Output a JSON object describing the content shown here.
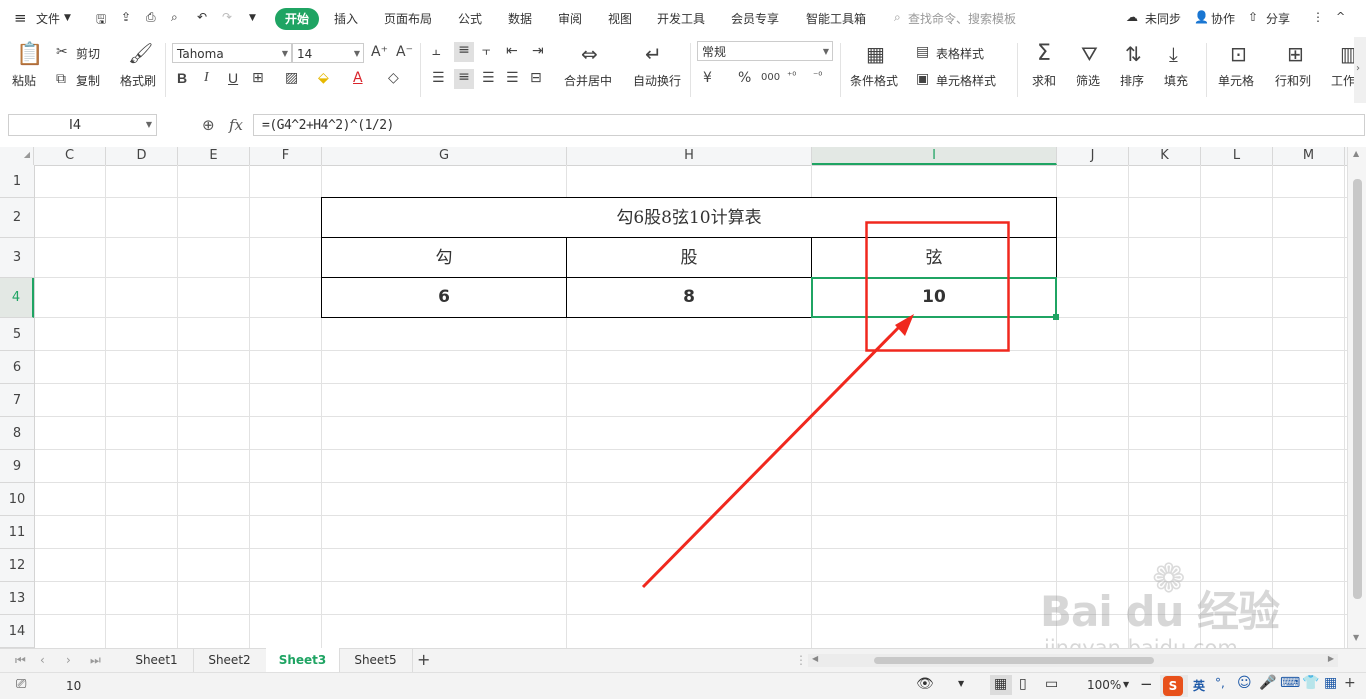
{
  "menu": {
    "file_label": "文件",
    "tabs": [
      "开始",
      "插入",
      "页面布局",
      "公式",
      "数据",
      "审阅",
      "视图",
      "开发工具",
      "会员专享",
      "智能工具箱"
    ],
    "search_placeholder": "查找命令、搜索模板",
    "sync": "未同步",
    "collab": "协作",
    "share": "分享"
  },
  "ribbon": {
    "paste": "粘贴",
    "cut": "剪切",
    "copy": "复制",
    "format_painter": "格式刷",
    "font_name": "Tahoma",
    "font_size": "14",
    "bold": "B",
    "italic": "I",
    "underline": "U",
    "merge_center": "合并居中",
    "wrap_text": "自动换行",
    "number_format": "常规",
    "currency": "¥",
    "percent": "%",
    "thousands": "000",
    "cond_format": "条件格式",
    "table_style": "表格样式",
    "cell_style": "单元格样式",
    "sum": "求和",
    "filter": "筛选",
    "sort": "排序",
    "fill": "填充",
    "cell": "单元格",
    "row_col": "行和列",
    "worksheet": "工作"
  },
  "formula_bar": {
    "name_box": "I4",
    "fx": "fx",
    "formula": "=(G4^2+H4^2)^(1/2)"
  },
  "columns": [
    "C",
    "D",
    "E",
    "F",
    "G",
    "H",
    "I",
    "J",
    "K",
    "L",
    "M"
  ],
  "rows": [
    "1",
    "2",
    "3",
    "4",
    "5",
    "6",
    "7",
    "8",
    "9",
    "10",
    "11",
    "12",
    "13",
    "14"
  ],
  "table": {
    "title": "勾6股8弦10计算表",
    "headers": [
      "勾",
      "股",
      "弦"
    ],
    "values": [
      "6",
      "8",
      "10"
    ]
  },
  "sheets": [
    "Sheet1",
    "Sheet2",
    "Sheet3",
    "Sheet5"
  ],
  "active_sheet": "Sheet3",
  "status": {
    "value": "10",
    "zoom": "100%",
    "ime": "英"
  },
  "watermark": {
    "brand": "Bai du 经验",
    "url": "jingyan.baidu.com"
  },
  "colors": {
    "accent": "#1fa463",
    "annotation": "#f0281e"
  }
}
